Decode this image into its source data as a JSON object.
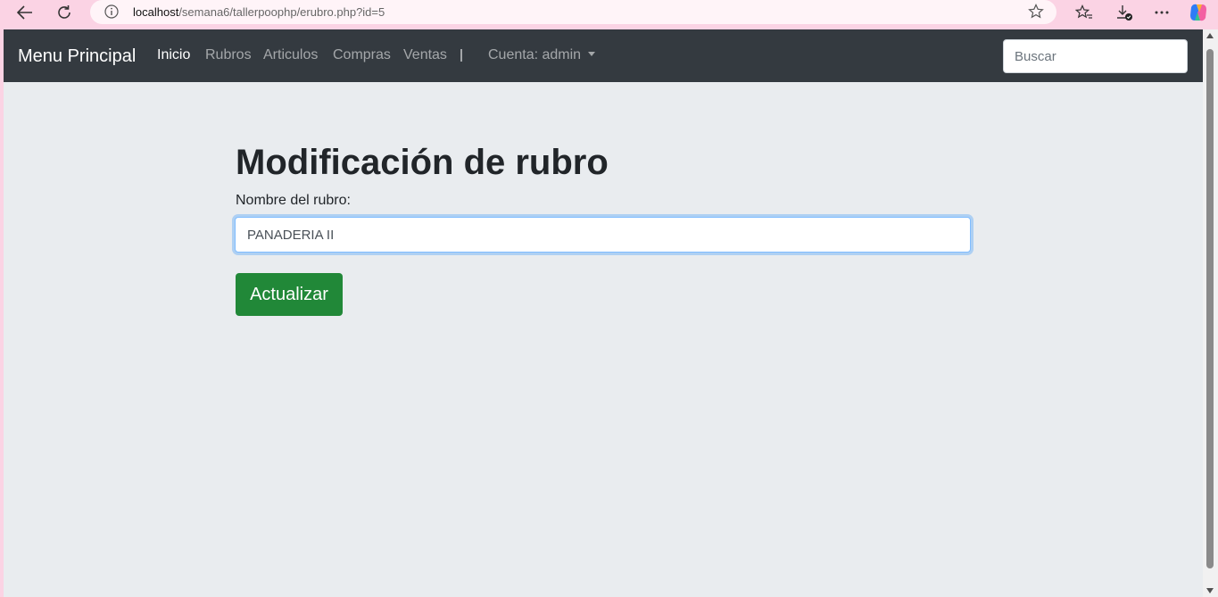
{
  "browser": {
    "url_host": "localhost",
    "url_path": "/semana6/tallerpoophp/erubro.php?id=5",
    "icons": [
      "back-arrow-icon",
      "reload-icon",
      "info-icon",
      "star-icon",
      "favorites-icon",
      "downloads-icon",
      "more-icon",
      "copilot-icon"
    ]
  },
  "navbar": {
    "brand": "Menu Principal",
    "links": [
      "Inicio",
      "Rubros",
      "Articulos",
      "Compras",
      "Ventas"
    ],
    "account": "Cuenta: admin",
    "search_placeholder": "Buscar"
  },
  "form": {
    "title": "Modificación de rubro",
    "label": "Nombre del rubro:",
    "value": "PANADERIA II",
    "submit": "Actualizar"
  },
  "colors": {
    "navbar": "#343a40",
    "page_bg": "#e9ecef",
    "button": "#218838",
    "chrome": "#fbd3e4"
  }
}
